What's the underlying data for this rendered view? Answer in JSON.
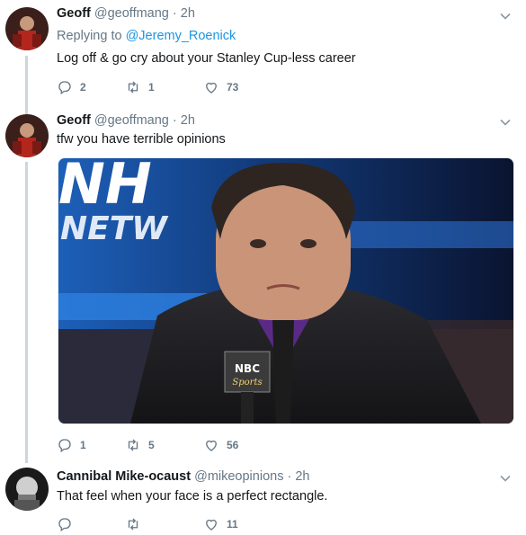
{
  "tweets": [
    {
      "name": "Geoff",
      "handle": "@geoffmang",
      "time": "2h",
      "replying_label": "Replying to",
      "replying_to": "@Jeremy_Roenick",
      "text": "Log off & go cry about your Stanley Cup-less career",
      "replies": "2",
      "retweets": "1",
      "likes": "73"
    },
    {
      "name": "Geoff",
      "handle": "@geoffmang",
      "time": "2h",
      "text": "tfw you have terrible opinions",
      "replies": "1",
      "retweets": "5",
      "likes": "56",
      "media": {
        "logo_line1": "NH",
        "logo_line2": "NETW",
        "mic_label": "NBC",
        "mic_sub": "Sports"
      }
    },
    {
      "name": "Cannibal Mike-ocaust",
      "handle": "@mikeopinions",
      "time": "2h",
      "text": "That feel when your face is a perfect rectangle.",
      "replies": "",
      "retweets": "",
      "likes": "11"
    }
  ],
  "separator": "·",
  "icons": [
    "reply-icon",
    "retweet-icon",
    "like-icon",
    "chevron-down-icon"
  ],
  "colors": {
    "mention": "#1b95e0",
    "muted": "#657786",
    "thread_line": "#ccd6dd"
  }
}
